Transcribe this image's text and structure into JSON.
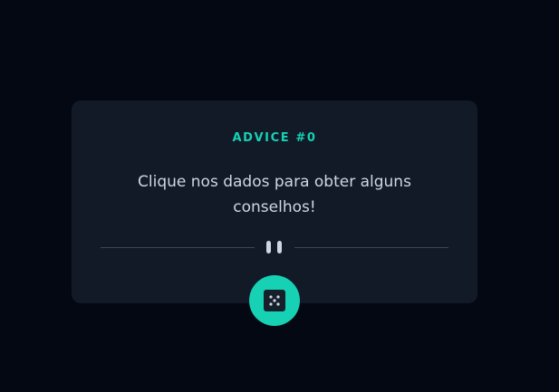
{
  "advice": {
    "title": "ADVICE #0",
    "text": "Clique nos dados para obter alguns conselhos!"
  },
  "icons": {
    "divider": "pause-icon",
    "button": "dice-icon"
  },
  "colors": {
    "background": "#040812",
    "card": "#121a28",
    "accent": "#16d1b4",
    "text": "#cfd6e2",
    "divider": "#3a4659"
  }
}
